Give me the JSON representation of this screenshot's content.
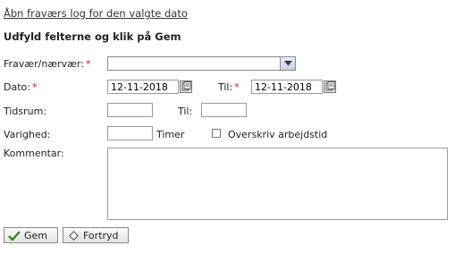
{
  "top_link": "Åbn fraværs log for den valgte dato",
  "heading": "Udfyld felterne og klik på Gem",
  "form": {
    "absence_label": "Fravær/nærvær:",
    "absence_value": "",
    "date_label": "Dato:",
    "date_value": "12-11-2018",
    "to_label": "Til:",
    "to_date_value": "12-11-2018",
    "timespan_label": "Tidsrum:",
    "timespan_from": "",
    "timespan_to_label": "Til:",
    "timespan_to": "",
    "duration_label": "Varighed:",
    "duration_value": "",
    "duration_unit": "Timer",
    "override_label": "Overskriv arbejdstid",
    "override_checked": false,
    "comment_label": "Kommentar:",
    "comment_value": "",
    "required_marker": "*"
  },
  "buttons": {
    "save": "Gem",
    "cancel": "Fortryd"
  },
  "colors": {
    "required": "#c41b1b",
    "check": "#2f8a1c"
  }
}
